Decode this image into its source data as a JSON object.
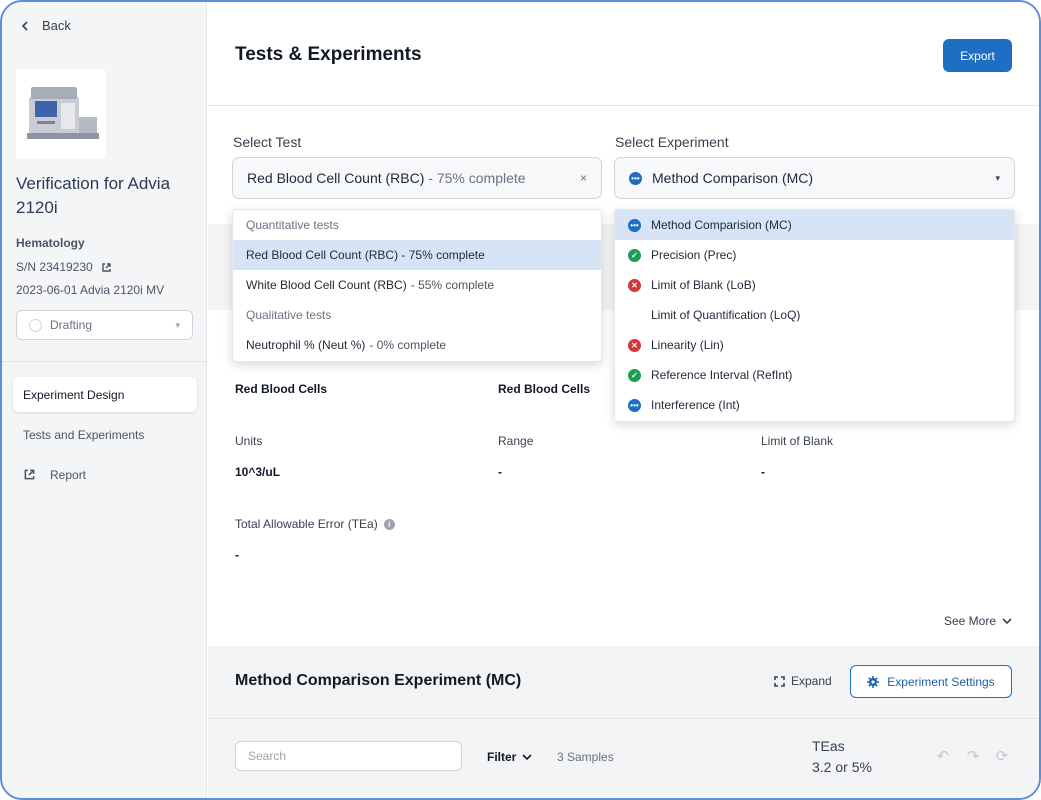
{
  "sidebar": {
    "back_label": "Back",
    "device_title": "Verification for Advia 2120i",
    "category": "Hematology",
    "serial": "S/N 23419230",
    "date_model": "2023-06-01 Advia 2120i MV",
    "status": "Drafting",
    "nav": [
      {
        "label": "Experiment Design"
      },
      {
        "label": "Tests and Experiments"
      },
      {
        "label": "Report"
      }
    ]
  },
  "header": {
    "title": "Tests & Experiments",
    "export_label": "Export"
  },
  "select_test": {
    "label": "Select Test",
    "value": "Red Blood Cell Count (RBC)",
    "value_suffix": "- 75% complete",
    "clear_icon": "×",
    "options": {
      "group_quant": "Quantitative tests",
      "rbc_name": "Red Blood Cell Count (RBC) - 75% complete",
      "wbc_name": "White Blood Cell Count (RBC)",
      "wbc_suffix": "- 55% complete",
      "group_qual": "Qualitative tests",
      "neut_name": "Neutrophil % (Neut %)",
      "neut_suffix": "- 0% complete"
    }
  },
  "select_experiment": {
    "label": "Select Experiment",
    "value": "Method Comparison (MC)",
    "options": [
      {
        "label": "Method Comparision (MC)",
        "status": "in-progress"
      },
      {
        "label": "Precision (Prec)",
        "status": "complete"
      },
      {
        "label": "Limit of Blank (LoB)",
        "status": "failed"
      },
      {
        "label": "Limit of Quantification (LoQ)",
        "status": "none"
      },
      {
        "label": "Linearity (Lin)",
        "status": "failed"
      },
      {
        "label": "Reference Interval (RefInt)",
        "status": "complete"
      },
      {
        "label": "Interference (Int)",
        "status": "in-progress"
      }
    ]
  },
  "details": {
    "analyte_1": "Red Blood Cells",
    "analyte_2": "Red Blood Cells",
    "units_label": "Units",
    "units_value": "10^3/uL",
    "range_label": "Range",
    "range_value": "-",
    "lob_label": "Limit of Blank",
    "lob_value": "-",
    "tea_label": "Total Allowable Error (TEa)",
    "tea_value": "-",
    "see_more": "See More"
  },
  "experiment": {
    "title": "Method Comparison Experiment (MC)",
    "expand_label": "Expand",
    "settings_label": "Experiment Settings",
    "search_placeholder": "Search",
    "filter_label": "Filter",
    "samples": "3 Samples",
    "teas_label": "TEas",
    "teas_value": "3.2 or 5%"
  },
  "colors": {
    "accent": "#1e6fc3",
    "complete": "#1f9d55",
    "failed": "#d23a3a",
    "selected_row": "#d6e4f5"
  }
}
